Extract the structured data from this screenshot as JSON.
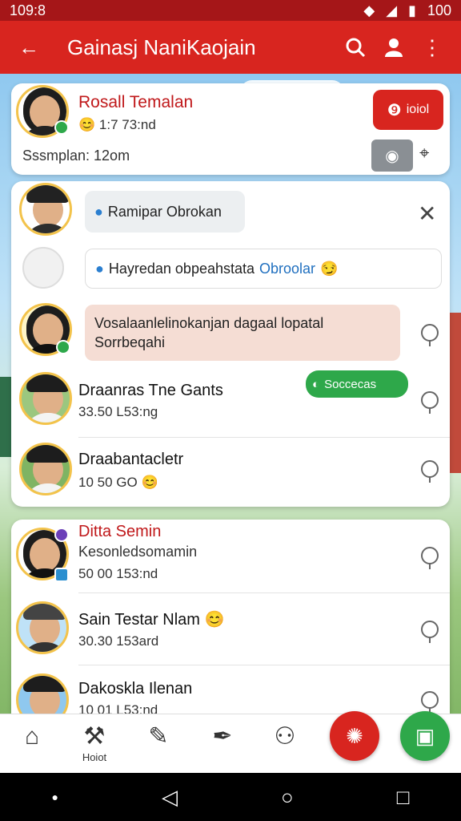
{
  "status": {
    "time": "109:8",
    "battery": "100"
  },
  "appbar": {
    "title": "Gainasj NaniKaojain"
  },
  "top_card": {
    "name": "Rosall Temalan",
    "time": "1:7 73:nd",
    "meta": "Sssmplan: 12om",
    "action_label": "ioiol"
  },
  "chat": {
    "bubble1": "Ramipar Obrokan",
    "bubble2_text": "Hayredan obpeahstata",
    "bubble2_link": "Obroolar",
    "bubble3_line1": "Vosalaanlelinokanjan dagaal lopatal",
    "bubble3_line2": "Sorrbeqahi"
  },
  "rows1": [
    {
      "name": "Draanras Tne Gants",
      "sub": "33.50 L53:ng",
      "tag": "Soccecas"
    },
    {
      "name": "Draabantacletr",
      "sub": "10 50 GO"
    }
  ],
  "rows2": [
    {
      "name": "Ditta Semin",
      "sub": "Kesonledsomamin",
      "sub2": "50 00 153:nd"
    },
    {
      "name": "Sain Testar Nlam",
      "sub": "30.30 153ard"
    },
    {
      "name": "Dakoskla Ilenan",
      "sub": "10 01 L53:nd"
    }
  ],
  "nav": {
    "item2_label": "Hoiot"
  },
  "colors": {
    "primary_red": "#d8251f",
    "green": "#2ea84a"
  }
}
